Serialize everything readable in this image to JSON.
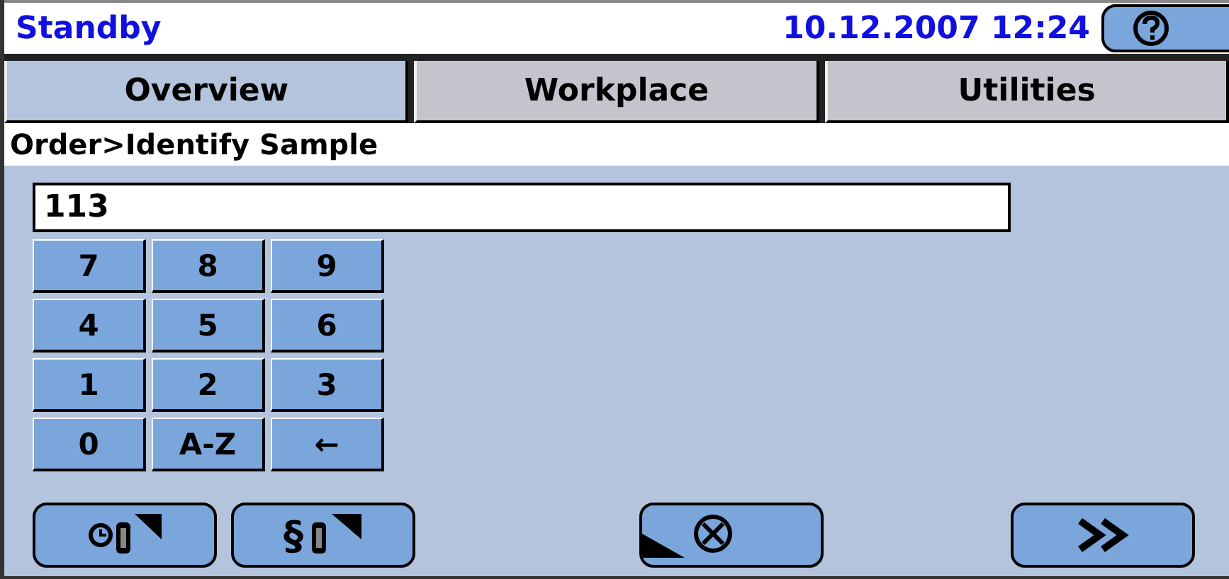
{
  "header": {
    "status": "Standby",
    "datetime": "10.12.2007 12:24"
  },
  "tabs": [
    {
      "label": "Overview",
      "selected": true
    },
    {
      "label": "Workplace",
      "selected": false
    },
    {
      "label": "Utilities",
      "selected": false
    }
  ],
  "breadcrumb": "Order>Identify Sample",
  "input": {
    "value": "113"
  },
  "keypad": [
    "7",
    "8",
    "9",
    "4",
    "5",
    "6",
    "1",
    "2",
    "3",
    "0",
    "A-Z",
    "←"
  ],
  "actions": [
    {
      "kind": "clock-tube"
    },
    {
      "kind": "section-tube",
      "symbol": "§"
    },
    {
      "kind": "cancel"
    },
    {
      "kind": "next"
    }
  ]
}
